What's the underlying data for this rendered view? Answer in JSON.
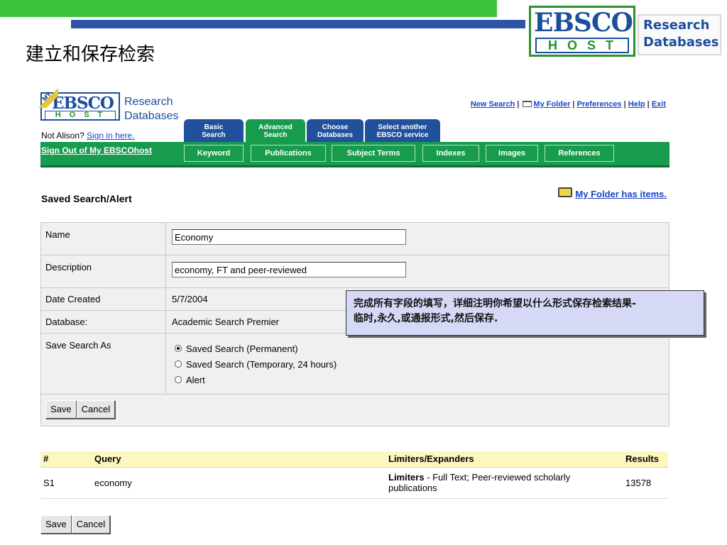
{
  "slide": {
    "title": "建立和保存检索",
    "logo": {
      "ebsco": "EBSCO",
      "host": "HOST",
      "research": "Research",
      "databases": "Databases"
    }
  },
  "app": {
    "logo": {
      "my": "MY",
      "ebsco": "EBSCO",
      "host": "HOST",
      "research": "Research",
      "databases": "Databases"
    },
    "not_signed_in": "Not Alison?",
    "sign_in_link": "Sign in here.",
    "sign_out": "Sign Out of My EBSCOhost",
    "top_links": {
      "new_search": "New Search",
      "my_folder": "My Folder",
      "preferences": "Preferences",
      "help": "Help",
      "exit": "Exit"
    },
    "tabs": [
      {
        "line1": "Basic",
        "line2": "Search"
      },
      {
        "line1": "Advanced",
        "line2": "Search"
      },
      {
        "line1": "Choose",
        "line2": "Databases"
      },
      {
        "line1": "Select another",
        "line2": "EBSCO service"
      }
    ],
    "subtabs": [
      "Keyword",
      "Publications",
      "Subject Terms",
      "Indexes",
      "Images",
      "References"
    ]
  },
  "saved": {
    "title": "Saved Search/Alert",
    "folder_msg": "My Folder has items."
  },
  "form": {
    "name_label": "Name",
    "name_value": "Economy",
    "desc_label": "Description",
    "desc_value": "economy, FT and peer-reviewed",
    "date_label": "Date Created",
    "date_value": "5/7/2004",
    "db_label": "Database:",
    "db_value": "Academic Search Premier",
    "save_as_label": "Save Search As",
    "options": [
      "Saved Search (Permanent)",
      "Saved Search (Temporary, 24 hours)",
      "Alert"
    ],
    "selected_option": 0,
    "save": "Save",
    "cancel": "Cancel"
  },
  "callout": {
    "line1": "完成所有字段的填写，详细注明你希望以什么形式保存检索结果-",
    "line2": "临时,永久,或通报形式,然后保存."
  },
  "results": {
    "headers": [
      "#",
      "Query",
      "Limiters/Expanders",
      "Results"
    ],
    "rows": [
      {
        "id": "S1",
        "query": "economy",
        "limiter_bold": "Limiters",
        "limiter_text": " - Full Text; Peer-reviewed scholarly publications",
        "results": "13578"
      }
    ]
  },
  "bottom": {
    "save": "Save",
    "cancel": "Cancel"
  },
  "colors": {
    "green_bar": "#3dc43d",
    "blue_bar": "#2f54a6",
    "tab_blue": "#21509c",
    "tab_green": "#179c4e",
    "link": "#1a45c9",
    "callout_bg": "#d6d9f6",
    "header_yellow": "#fcf7bf"
  }
}
